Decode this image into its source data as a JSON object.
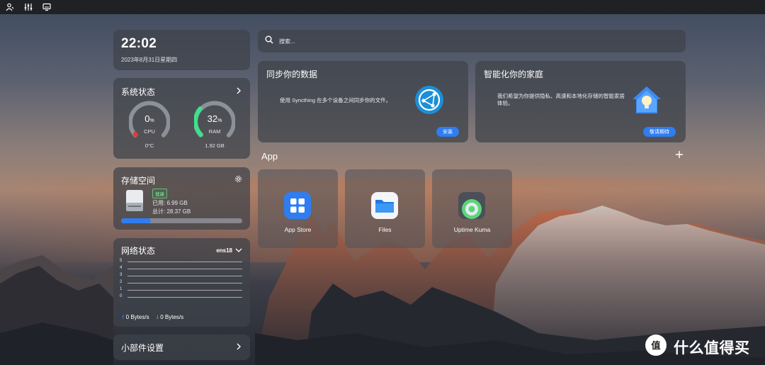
{
  "topbar": {
    "icons": [
      "user-settings-icon",
      "sliders-icon",
      "monitor-icon"
    ]
  },
  "clock": {
    "time": "22:02",
    "date": "2023年8月31日星期四"
  },
  "system_status": {
    "title": "系统状态",
    "cpu": {
      "value": "0",
      "unit": "%",
      "label": "CPU",
      "sub": "0°C",
      "fraction": 0.0,
      "color": "#e53935"
    },
    "ram": {
      "value": "32",
      "unit": "%",
      "label": "RAM",
      "sub": "1.92 GB",
      "fraction": 0.32,
      "color": "#3fe08c"
    }
  },
  "storage": {
    "title": "存储空间",
    "health": "健康",
    "used": "已用: 6.99 GB",
    "total": "总计: 28.37 GB",
    "used_fraction": 0.246
  },
  "network": {
    "title": "网络状态",
    "interface": "ens18",
    "y_ticks": [
      "5",
      "4",
      "3",
      "2",
      "1",
      "0"
    ],
    "upload": "0 Bytes/s",
    "download": "0 Bytes/s"
  },
  "widgets": {
    "title": "小部件设置"
  },
  "search": {
    "placeholder": "搜索..."
  },
  "promos": [
    {
      "title": "同步你的数据",
      "desc": "使用 Syncthing 在多个设备之间同步你的文件。",
      "button": "安装"
    },
    {
      "title": "智能化你的家庭",
      "desc": "我们希望为你提供隐私、高速和本地化存储的智能家居体验。",
      "button": "敬请期待"
    }
  ],
  "apps": {
    "title": "App",
    "items": [
      {
        "label": "App Store"
      },
      {
        "label": "Files"
      },
      {
        "label": "Uptime Kuma"
      }
    ]
  },
  "watermark": {
    "text": "什么值得买"
  },
  "colors": {
    "accent": "#2f7df0",
    "card": "#3e424a"
  }
}
